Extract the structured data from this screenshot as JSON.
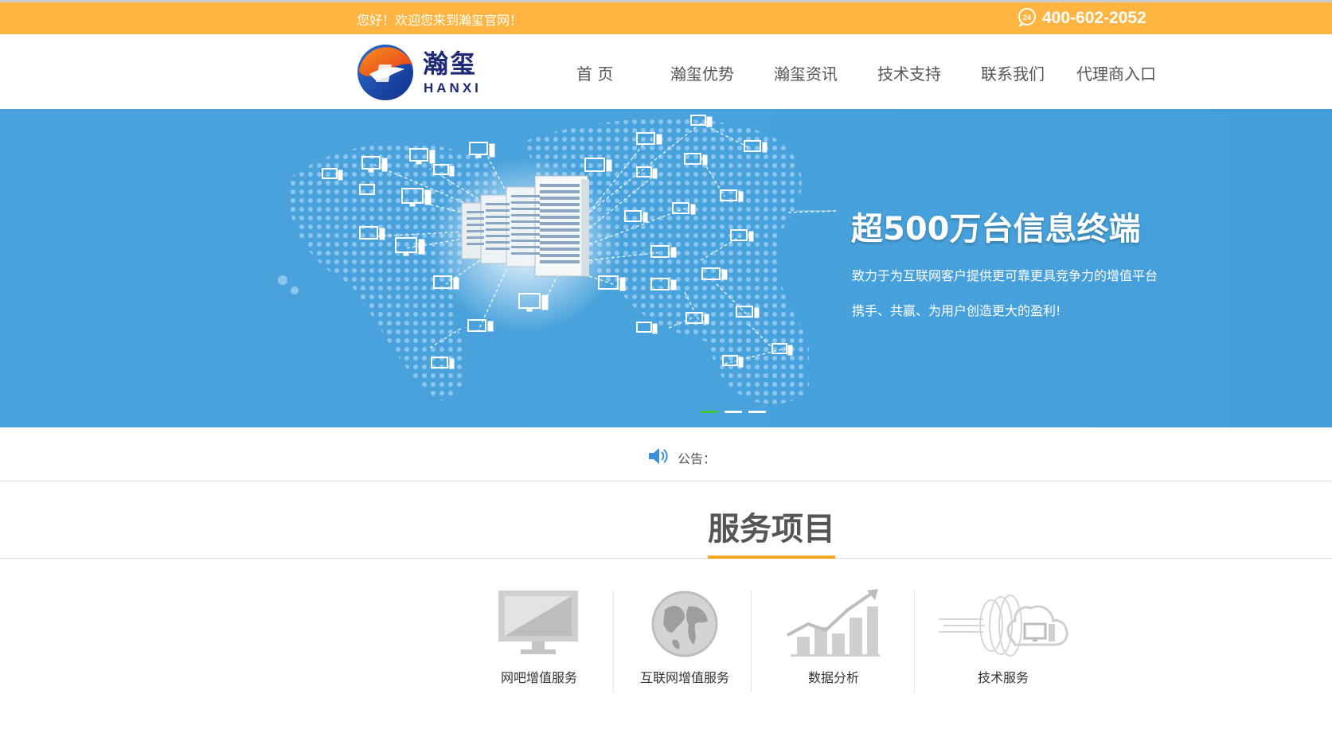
{
  "topbar": {
    "welcome": "您好！欢迎您来到瀚玺官网！",
    "phone": "400-602-2052",
    "phone_icon": "phone-24h-icon"
  },
  "brand": {
    "name_cn": "瀚玺",
    "name_en": "HANXI"
  },
  "nav": {
    "items": [
      {
        "label": "首  页"
      },
      {
        "label": "瀚玺优势"
      },
      {
        "label": "瀚玺资讯"
      },
      {
        "label": "技术支持"
      },
      {
        "label": "联系我们"
      },
      {
        "label": "代理商入口"
      }
    ]
  },
  "banner": {
    "headline": "超500万台信息终端",
    "line1": "致力于为互联网客户提供更可靠更具竞争力的增值平台",
    "line2": "携手、共赢、为用户创造更大的盈利!",
    "slides": 3,
    "active_slide": 1
  },
  "notice": {
    "label": "公告："
  },
  "services": {
    "title": "服务项目",
    "items": [
      {
        "label": "网吧增值服务",
        "icon": "monitor-icon"
      },
      {
        "label": "互联网增值服务",
        "icon": "globe-icon"
      },
      {
        "label": "数据分析",
        "icon": "bar-chart-icon"
      },
      {
        "label": "技术服务",
        "icon": "cloud-computer-icon"
      }
    ]
  },
  "colors": {
    "topbar": "#fdb441",
    "banner": "#48a2dc",
    "brand_blue": "#1f2a78",
    "accent": "#f5a623"
  }
}
